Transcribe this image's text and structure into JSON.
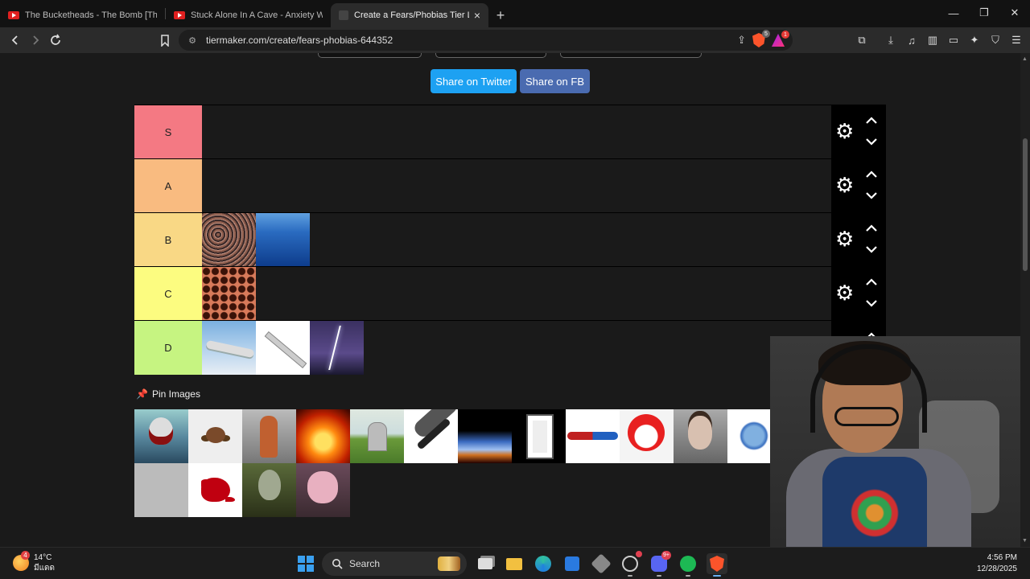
{
  "browser": {
    "tabs": [
      {
        "label": "The Bucketheads - The Bomb [These",
        "icon": "youtube-icon",
        "active": false
      },
      {
        "label": "Stuck Alone In A Cave - Anxiety Warr",
        "icon": "youtube-icon",
        "active": false
      },
      {
        "label": "Create a Fears/Phobias Tier List",
        "icon": "tiermaker-icon",
        "active": true
      }
    ],
    "new_tab": "+",
    "window_controls": {
      "minimize": "—",
      "restore": "❐",
      "close": "✕"
    },
    "url": "tiermaker.com/create/fears-phobias-644352",
    "shield_count": "5",
    "rewards_count": "1"
  },
  "page": {
    "share_twitter": "Share on Twitter",
    "share_fb": "Share on FB",
    "tiers": [
      {
        "label": "S",
        "color": "#f47983",
        "items": []
      },
      {
        "label": "A",
        "color": "#f9bb80",
        "items": []
      },
      {
        "label": "B",
        "color": "#f9d885",
        "items": [
          "crowd",
          "ocean"
        ]
      },
      {
        "label": "C",
        "color": "#fcfc80",
        "items": [
          "holes"
        ]
      },
      {
        "label": "D",
        "color": "#c6f481",
        "items": [
          "airplane",
          "needle",
          "lightning"
        ]
      }
    ],
    "pin_label": "Pin Images",
    "pool_items": [
      "shark",
      "spider",
      "doll",
      "fire",
      "grave",
      "microphone",
      "earth-impact",
      "window",
      "knot",
      "clown",
      "man-portrait",
      "virus",
      "blood",
      "alien",
      "screaming-woman"
    ]
  },
  "taskbar": {
    "weather_temp": "14°C",
    "weather_desc": "มีแดด",
    "weather_badge": "4",
    "search_label": "Search",
    "discord_badge": "9+",
    "time": "4:56 PM",
    "date": "12/28/2025"
  }
}
